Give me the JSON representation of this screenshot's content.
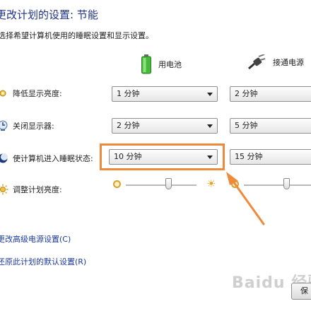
{
  "header": {
    "title": "更改计划的设置: 节能",
    "subtitle": "选择希望计算机使用的睡眠设置和显示设置。"
  },
  "columns": {
    "battery_label": "用电池",
    "plugged_label": "接通电源"
  },
  "settings": [
    {
      "label": "降低显示亮度:",
      "icon": "dim-display-icon",
      "battery": "1 分钟",
      "plugged": "2 分钟"
    },
    {
      "label": "关闭显示器:",
      "icon": "monitor-icon",
      "battery": "2 分钟",
      "plugged": "5 分钟"
    },
    {
      "label": "使计算机进入睡眠状态:",
      "icon": "sleep-moon-icon",
      "battery": "10 分钟",
      "plugged": "15 分钟"
    }
  ],
  "brightness": {
    "label": "调整计划亮度:",
    "battery_level": 0.6,
    "plugged_level": 0.6
  },
  "links": {
    "advanced": "更改高级电源设置(C)",
    "restore": "还原此计划的默认设置(R)"
  },
  "buttons": {
    "save": "保"
  },
  "watermark": "Baidu 经验",
  "colors": {
    "title": "#1e3287",
    "link": "#1a3aa5",
    "annotation": "#f08a3b"
  }
}
